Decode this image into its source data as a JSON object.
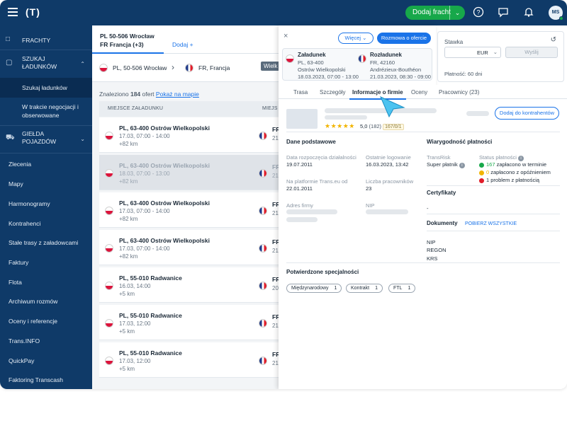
{
  "topbar": {
    "logo": "(T)",
    "add_freight_label": "Dodaj fracht",
    "avatar_initials": "MS"
  },
  "sidebar": {
    "items": [
      {
        "label": "FRACHTY",
        "icon": "freight-icon"
      },
      {
        "label": "SZUKAJ ŁADUNKÓW",
        "icon": "box-icon"
      },
      {
        "label": "Szukaj ładunków"
      },
      {
        "label": "W trakcie negocjacji i obserwowane"
      },
      {
        "label": "GIEŁDA POJAZDÓW",
        "icon": "truck-icon"
      },
      {
        "label": "Zlecenia"
      },
      {
        "label": "Mapy"
      },
      {
        "label": "Harmonogramy"
      },
      {
        "label": "Kontrahenci"
      },
      {
        "label": "Stałe trasy z załadowcami"
      },
      {
        "label": "Faktury"
      },
      {
        "label": "Flota"
      },
      {
        "label": "Archiwum rozmów"
      },
      {
        "label": "Oceny i referencje"
      },
      {
        "label": "Trans.INFO"
      },
      {
        "label": "QuickPay"
      },
      {
        "label": "Faktoring Transcash"
      }
    ]
  },
  "list": {
    "tab_line1": "PL 50-506 Wrocław",
    "tab_line2": "FR Francja (+3)",
    "tab_add": "Dodaj +",
    "route_from": "PL, 50-506 Wrocław",
    "route_to": "FR, Francja",
    "route_more": "Wielk",
    "found_prefix": "Znaleziono",
    "found_count": "184",
    "found_suffix": "ofert",
    "show_on_map": "Pokaż na mapie",
    "col_loading": "MIEJSCE ZAŁADUNKU",
    "col_unloading": "MIEJS",
    "cards": [
      {
        "city": "PL, 63-400 Ostrów Wielkopolski",
        "date": "17.03, 07:00 - 14:00",
        "km": "+82 km",
        "dest": "FR",
        "dest_date": "21."
      },
      {
        "city": "PL, 63-400 Ostrów Wielkopolski",
        "date": "18.03, 07:00 - 13:00",
        "km": "+82 km",
        "dest": "FR",
        "dest_date": "21."
      },
      {
        "city": "PL, 63-400 Ostrów Wielkopolski",
        "date": "17.03, 07:00 - 14:00",
        "km": "+82 km",
        "dest": "FR",
        "dest_date": "21."
      },
      {
        "city": "PL, 63-400 Ostrów Wielkopolski",
        "date": "17.03, 07:00 - 14:00",
        "km": "+82 km",
        "dest": "FR",
        "dest_date": "21."
      },
      {
        "city": "PL, 55-010 Radwanice",
        "date": "16.03, 14:00",
        "km": "+5 km",
        "dest": "FR",
        "dest_date": "20."
      },
      {
        "city": "PL, 55-010 Radwanice",
        "date": "17.03, 12:00",
        "km": "+5 km",
        "dest": "FR",
        "dest_date": "21."
      },
      {
        "city": "PL, 55-010 Radwanice",
        "date": "17.03, 12:00",
        "km": "+5 km",
        "dest": "FR",
        "dest_date": "21."
      }
    ]
  },
  "detail": {
    "close": "×",
    "more_label": "Więcej",
    "talk_label": "Rozmowa o ofercie",
    "loading_title": "Załadunek",
    "loading_line1": "PL, 63-400",
    "loading_line2": "Ostrów Wielkopolski",
    "loading_line3": "18.03.2023, 07:00 - 13:00",
    "unloading_title": "Rozładunek",
    "unloading_line1": "FR, 42160",
    "unloading_line2": "Andrézieux-Bouthéon",
    "unloading_line3": "21.03.2023, 08:30 - 09:00",
    "rate_label": "Stawka",
    "currency": "EUR",
    "send_label": "Wyślij",
    "payment": "Płatność: 60 dni",
    "tabs": [
      "Trasa",
      "Szczegóły",
      "Informacje o firmie",
      "Oceny",
      "Pracownicy (23)"
    ],
    "rating_value": "5,0",
    "rating_count": "(182)",
    "rating_badge": "167/0/1",
    "add_contractor_label": "Dodaj do kontrahentów",
    "basic_data_title": "Dane podstawowe",
    "start_label": "Data rozpoczęcia działalności",
    "start_value": "19.07.2011",
    "last_login_label": "Ostatnie logowanie",
    "last_login_value": "16.03.2023, 13:42",
    "platform_label": "Na platformie Trans.eu od",
    "platform_value": "22.01.2011",
    "employees_label": "Liczba pracowników",
    "employees_value": "23",
    "address_label": "Adres firmy",
    "nip_label": "NIP",
    "credibility_title": "Wiarygodność płatności",
    "transrisk_label": "TransRisk",
    "transrisk_value": "Super płatnik",
    "status_label": "Status płatności",
    "status_ok_count": "167",
    "status_ok_text": "zapłacono w terminie",
    "status_late_count": "0",
    "status_late_text": "zapłacono z opóźnieniem",
    "status_problem_count": "1",
    "status_problem_text": "problem z płatnością",
    "certs_title": "Certyfikaty",
    "certs_value": "-",
    "docs_title": "Dokumenty",
    "download_all": "POBIERZ WSZYSTKIE",
    "doc_nip": "NIP",
    "doc_regon": "REGON",
    "doc_krs": "KRS",
    "specs_title": "Potwierdzone specjalności",
    "specs": [
      {
        "label": "Międzynarodowy",
        "count": "1"
      },
      {
        "label": "Kontrakt",
        "count": "1"
      },
      {
        "label": "FTL",
        "count": "1"
      }
    ]
  },
  "colors": {
    "nav": "#0f3a68",
    "accent": "#1a73e8",
    "green": "#17a84a"
  }
}
